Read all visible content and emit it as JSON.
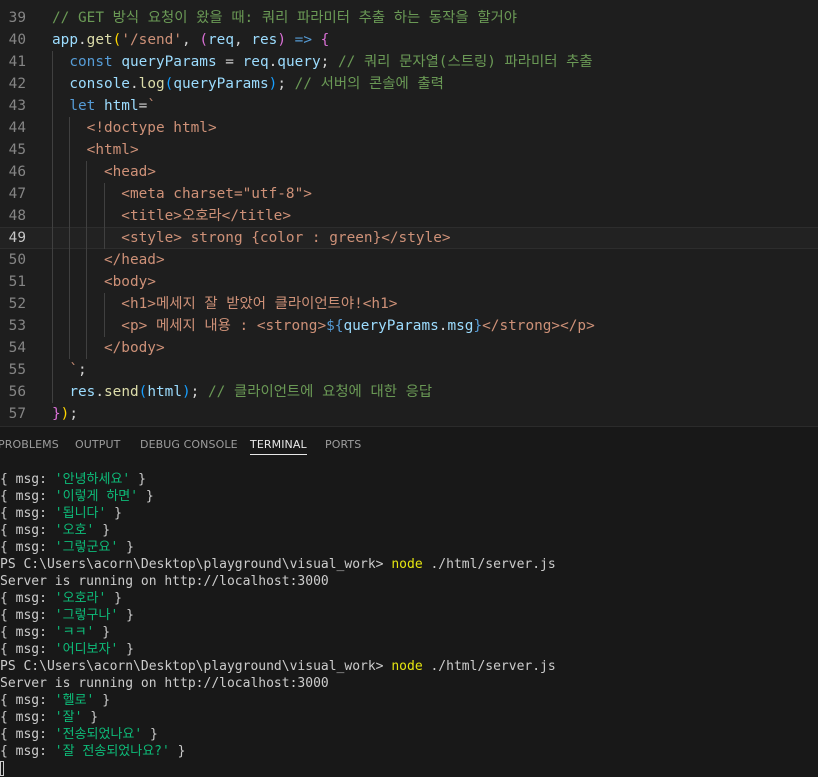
{
  "editor": {
    "lines": [
      {
        "num": "39",
        "tokens": [
          {
            "t": "// GET 방식 요청이 왔을 때: 쿼리 파라미터 추출 하는 동작을 할거야",
            "c": "tk-comment"
          }
        ]
      },
      {
        "num": "40",
        "tokens": [
          {
            "t": "app",
            "c": "tk-var"
          },
          {
            "t": ".",
            "c": "tk-punc"
          },
          {
            "t": "get",
            "c": "tk-fn"
          },
          {
            "t": "(",
            "c": "tk-br1"
          },
          {
            "t": "'/send'",
            "c": "tk-str"
          },
          {
            "t": ", ",
            "c": "tk-punc"
          },
          {
            "t": "(",
            "c": "tk-br2"
          },
          {
            "t": "req",
            "c": "tk-var"
          },
          {
            "t": ", ",
            "c": "tk-punc"
          },
          {
            "t": "res",
            "c": "tk-var"
          },
          {
            "t": ")",
            "c": "tk-br2"
          },
          {
            "t": " => ",
            "c": "tk-kw"
          },
          {
            "t": "{",
            "c": "tk-br2"
          }
        ]
      },
      {
        "num": "41",
        "tokens": [
          {
            "t": "  const ",
            "c": "tk-kw"
          },
          {
            "t": "queryParams",
            "c": "tk-var"
          },
          {
            "t": " = ",
            "c": "tk-op"
          },
          {
            "t": "req",
            "c": "tk-var"
          },
          {
            "t": ".",
            "c": "tk-punc"
          },
          {
            "t": "query",
            "c": "tk-var"
          },
          {
            "t": "; ",
            "c": "tk-punc"
          },
          {
            "t": "// 쿼리 문자열(스트링) 파라미터 추출",
            "c": "tk-comment"
          }
        ]
      },
      {
        "num": "42",
        "tokens": [
          {
            "t": "  console",
            "c": "tk-var"
          },
          {
            "t": ".",
            "c": "tk-punc"
          },
          {
            "t": "log",
            "c": "tk-fn"
          },
          {
            "t": "(",
            "c": "tk-br3"
          },
          {
            "t": "queryParams",
            "c": "tk-var"
          },
          {
            "t": ")",
            "c": "tk-br3"
          },
          {
            "t": "; ",
            "c": "tk-punc"
          },
          {
            "t": "// 서버의 콘솔에 출력",
            "c": "tk-comment"
          }
        ]
      },
      {
        "num": "43",
        "tokens": [
          {
            "t": "  let ",
            "c": "tk-kw"
          },
          {
            "t": "html",
            "c": "tk-var"
          },
          {
            "t": "=",
            "c": "tk-op"
          },
          {
            "t": "`",
            "c": "tk-tmpl"
          }
        ]
      },
      {
        "num": "44",
        "tokens": [
          {
            "t": "    <!doctype html>",
            "c": "tk-tmpl"
          }
        ]
      },
      {
        "num": "45",
        "tokens": [
          {
            "t": "    <html>",
            "c": "tk-tmpl"
          }
        ]
      },
      {
        "num": "46",
        "tokens": [
          {
            "t": "      <head>",
            "c": "tk-tmpl"
          }
        ]
      },
      {
        "num": "47",
        "tokens": [
          {
            "t": "        <meta charset=\"utf-8\">",
            "c": "tk-tmpl"
          }
        ]
      },
      {
        "num": "48",
        "tokens": [
          {
            "t": "        <title>오호라</title>",
            "c": "tk-tmpl"
          }
        ]
      },
      {
        "num": "49",
        "tokens": [
          {
            "t": "        <style> strong {color : green}</style>",
            "c": "tk-tmpl"
          }
        ]
      },
      {
        "num": "50",
        "tokens": [
          {
            "t": "      </head>",
            "c": "tk-tmpl"
          }
        ]
      },
      {
        "num": "51",
        "tokens": [
          {
            "t": "      <body>",
            "c": "tk-tmpl"
          }
        ]
      },
      {
        "num": "52",
        "tokens": [
          {
            "t": "        <h1>메세지 잘 받았어 클라이언트야!<h1>",
            "c": "tk-tmpl"
          }
        ]
      },
      {
        "num": "53",
        "tokens": [
          {
            "t": "        <p> 메세지 내용 : <strong>",
            "c": "tk-tmpl"
          },
          {
            "t": "${",
            "c": "tk-kw"
          },
          {
            "t": "queryParams",
            "c": "tk-var"
          },
          {
            "t": ".",
            "c": "tk-punc"
          },
          {
            "t": "msg",
            "c": "tk-var"
          },
          {
            "t": "}",
            "c": "tk-kw"
          },
          {
            "t": "</strong></p>",
            "c": "tk-tmpl"
          }
        ]
      },
      {
        "num": "54",
        "tokens": [
          {
            "t": "      </body>",
            "c": "tk-tmpl"
          }
        ]
      },
      {
        "num": "55",
        "tokens": [
          {
            "t": "  `",
            "c": "tk-tmpl"
          },
          {
            "t": ";",
            "c": "tk-punc"
          }
        ]
      },
      {
        "num": "56",
        "tokens": [
          {
            "t": "  res",
            "c": "tk-var"
          },
          {
            "t": ".",
            "c": "tk-punc"
          },
          {
            "t": "send",
            "c": "tk-fn"
          },
          {
            "t": "(",
            "c": "tk-br3"
          },
          {
            "t": "html",
            "c": "tk-var"
          },
          {
            "t": ")",
            "c": "tk-br3"
          },
          {
            "t": "; ",
            "c": "tk-punc"
          },
          {
            "t": "// 클라이언트에 요청에 대한 응답",
            "c": "tk-comment"
          }
        ]
      },
      {
        "num": "57",
        "tokens": [
          {
            "t": "}",
            "c": "tk-br2"
          },
          {
            "t": ")",
            "c": "tk-br1"
          },
          {
            "t": ";",
            "c": "tk-punc"
          }
        ]
      }
    ],
    "active_line": "49"
  },
  "panel": {
    "tabs": [
      {
        "label": "PROBLEMS",
        "active": false
      },
      {
        "label": "OUTPUT",
        "active": false
      },
      {
        "label": "DEBUG CONSOLE",
        "active": false
      },
      {
        "label": "TERMINAL",
        "active": true
      },
      {
        "label": "PORTS",
        "active": false
      }
    ]
  },
  "terminal": {
    "lines": [
      {
        "kind": "msg",
        "value": "'안녕하세요'"
      },
      {
        "kind": "msg",
        "value": "'이렇게 하면'"
      },
      {
        "kind": "msg",
        "value": "'됩니다'"
      },
      {
        "kind": "msg",
        "value": "'오호'"
      },
      {
        "kind": "msg",
        "value": "'그렇군요'"
      },
      {
        "kind": "prompt",
        "path": "PS C:\\Users\\acorn\\Desktop\\playground\\visual_work> ",
        "command": "node",
        "args": " ./html/server.js"
      },
      {
        "kind": "text",
        "value": "Server is running on http://localhost:3000"
      },
      {
        "kind": "msg",
        "value": "'오호라'"
      },
      {
        "kind": "msg",
        "value": "'그렇구나'"
      },
      {
        "kind": "msg",
        "value": "'ㅋㅋ'"
      },
      {
        "kind": "msg",
        "value": "'어디보자'"
      },
      {
        "kind": "prompt",
        "path": "PS C:\\Users\\acorn\\Desktop\\playground\\visual_work> ",
        "command": "node",
        "args": " ./html/server.js"
      },
      {
        "kind": "text",
        "value": "Server is running on http://localhost:3000"
      },
      {
        "kind": "msg",
        "value": "'헬로'"
      },
      {
        "kind": "msg",
        "value": "'잘'"
      },
      {
        "kind": "msg",
        "value": "'전송되었나요'"
      },
      {
        "kind": "msg",
        "value": "'잘 전송되었나요?'"
      }
    ],
    "msg_prefix": "{ msg: ",
    "msg_suffix": " }"
  }
}
